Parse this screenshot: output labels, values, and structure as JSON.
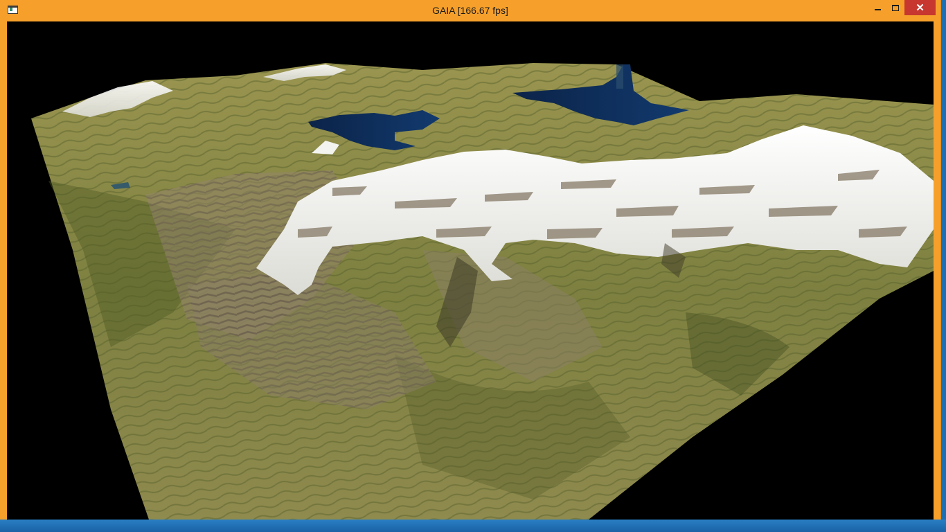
{
  "window": {
    "title": "GAIA [166.67 fps]",
    "frame_color": "#f6a02b",
    "close_color": "#c7372f"
  },
  "titlebar": {
    "app_icon": "application-window-icon",
    "minimize_icon": "minimize-icon",
    "maximize_icon": "maximize-icon",
    "close_icon": "close-icon",
    "close_glyph": "✕"
  },
  "scene": {
    "description_tag": "3d-terrain-render",
    "colors": {
      "background": "#000000",
      "grass": "#8a8a45",
      "grass_dark": "#5f6a2e",
      "rock": "#8f8168",
      "snow": "#f3f3f0",
      "water": "#0d2a55"
    }
  }
}
